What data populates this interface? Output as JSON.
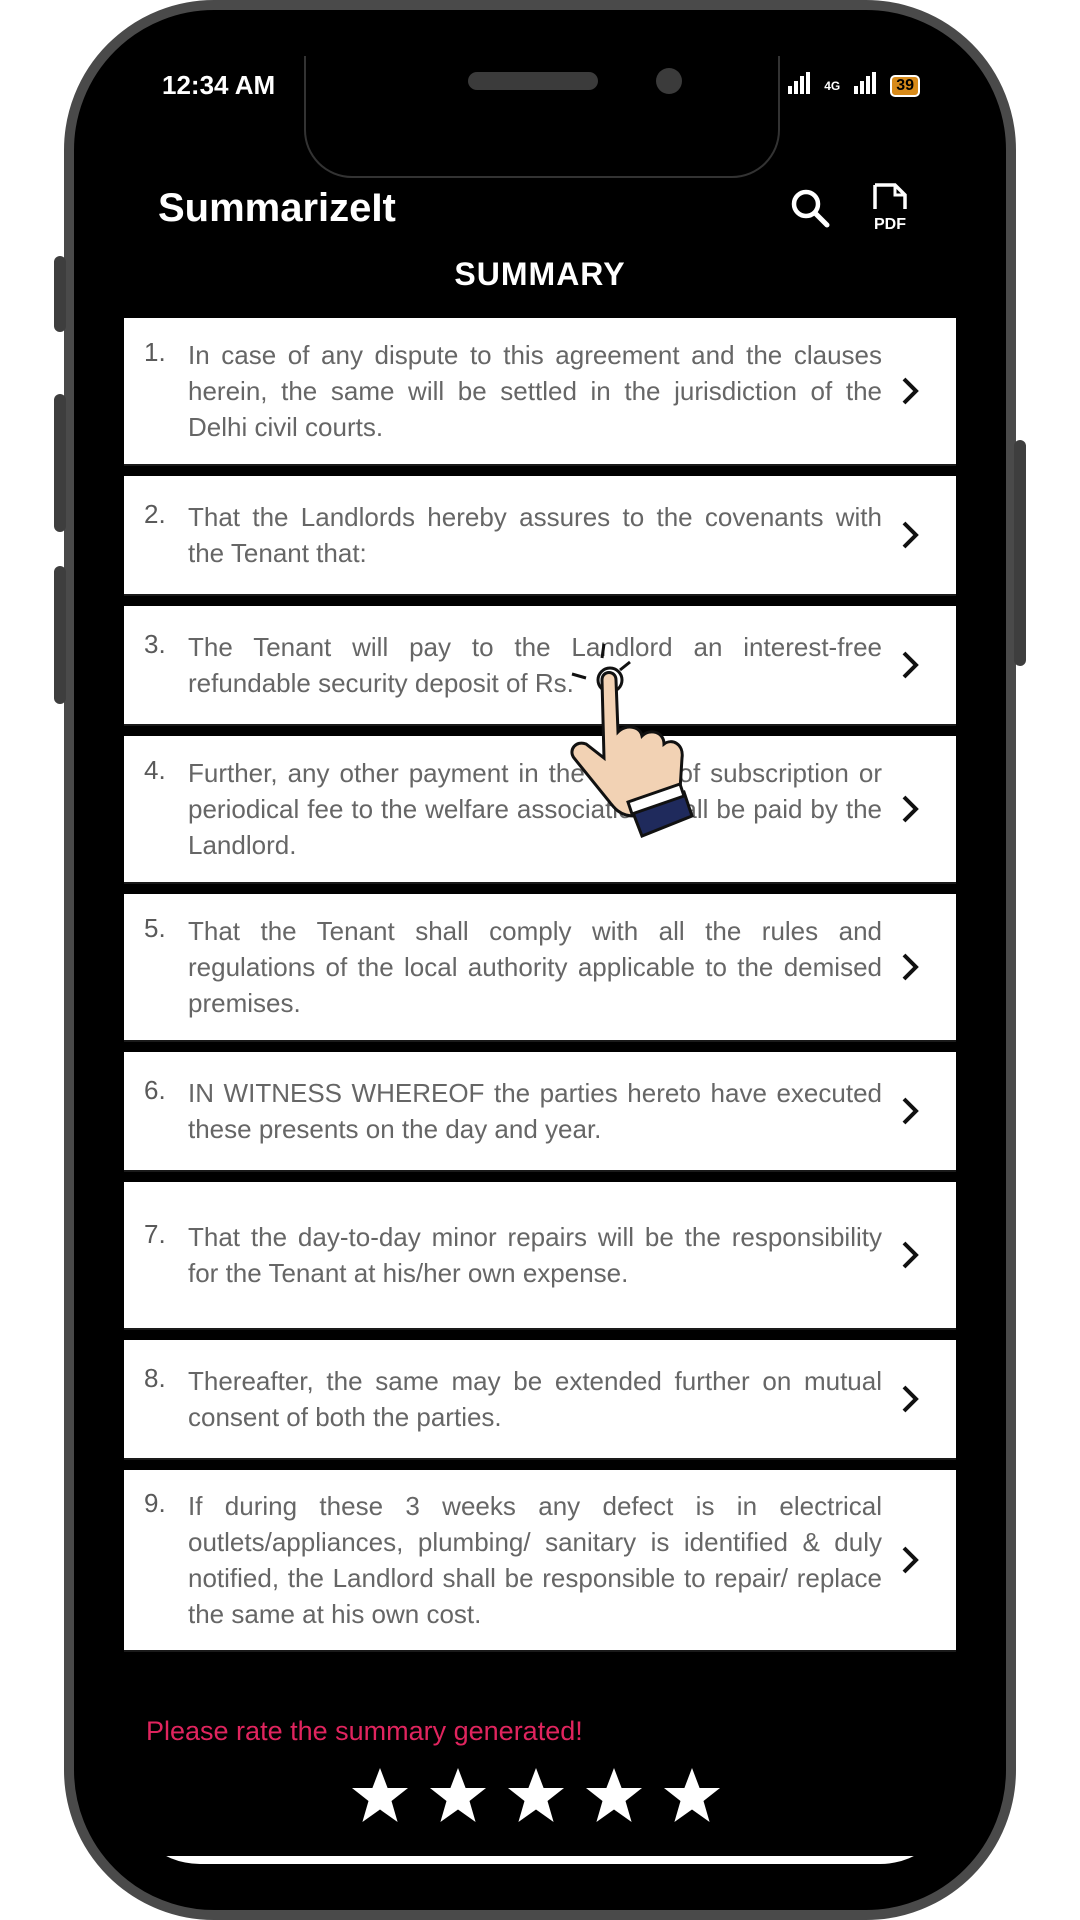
{
  "status_bar": {
    "time": "12:34 AM",
    "network_label": "4G",
    "battery": "39"
  },
  "app": {
    "title": "SummarizeIt",
    "search_icon": "search-icon",
    "pdf_icon": "pdf-icon",
    "pdf_label": "PDF"
  },
  "summary": {
    "heading": "SUMMARY",
    "items": [
      {
        "num": "1.",
        "text": "In case of any dispute to this agreement and the clauses herein, the same will be settled in the jurisdiction of the Delhi civil courts."
      },
      {
        "num": "2.",
        "text": "That the Landlords hereby assures to the covenants with the Tenant that:"
      },
      {
        "num": "3.",
        "text": "The Tenant will pay to the Landlord an interest-free refundable security deposit of Rs."
      },
      {
        "num": "4.",
        "text": "Further, any other payment in the nature of subscription or periodical fee to the welfare association shall be paid by the Landlord."
      },
      {
        "num": "5.",
        "text": "That the Tenant shall comply with all the rules and regulations of the local authority applicable to the demised premises."
      },
      {
        "num": "6.",
        "text": "IN WITNESS WHEREOF the parties hereto have executed these presents on the day and year."
      },
      {
        "num": "7.",
        "text": "That the day-to-day minor repairs will be the responsibility for the Tenant at his/her own expense."
      },
      {
        "num": "8.",
        "text": "Thereafter, the same may be extended further on mutual consent of both the parties."
      },
      {
        "num": "9.",
        "text": "If during these 3 weeks any defect is in electrical outlets/appliances, plumbing/ sanitary is identified & duly notified, the Landlord shall be responsible to repair/ replace the same at his own cost."
      }
    ]
  },
  "rating": {
    "prompt": "Please rate the summary generated!",
    "max_stars": 5,
    "prompt_color": "#e0245e"
  }
}
